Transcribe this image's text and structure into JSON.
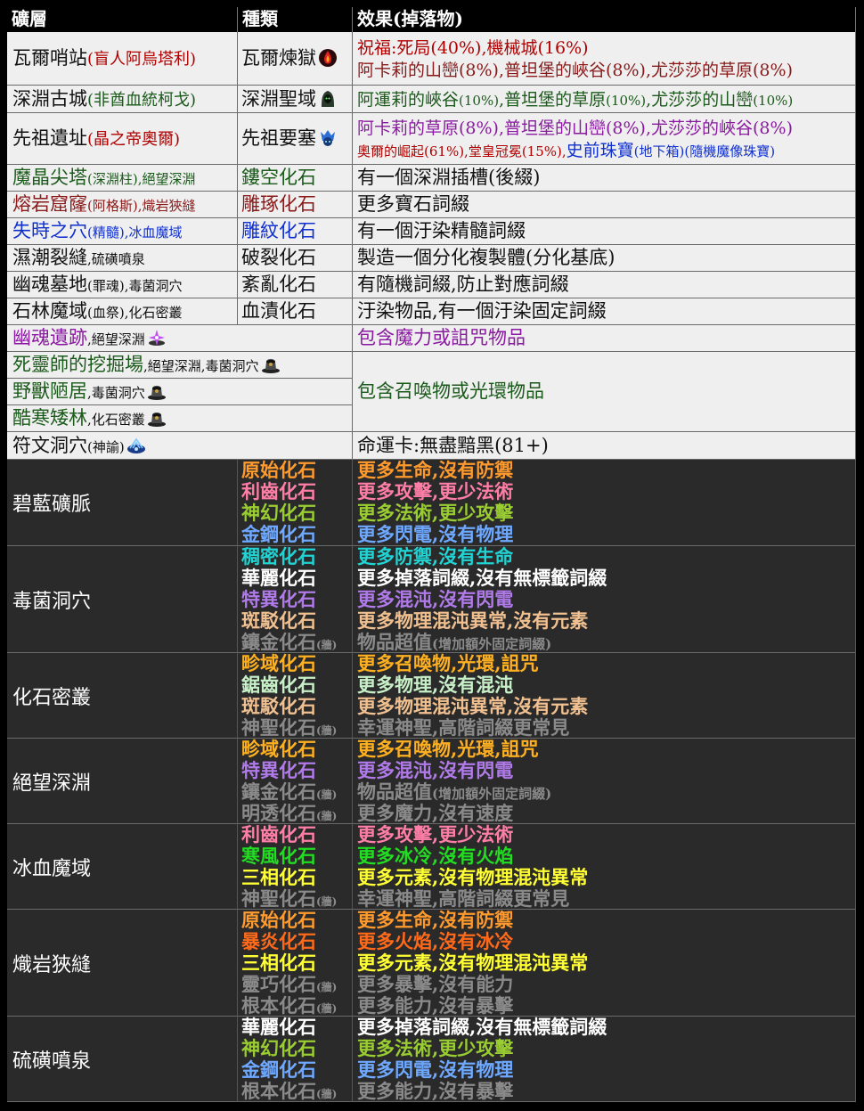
{
  "colors": {
    "red": "#b00000",
    "darkred": "#8a1a1a",
    "green": "#1a5a1a",
    "blue": "#1030d0",
    "purple": "#8a1aa0",
    "black": "#111111"
  },
  "header": {
    "col1": "礦層",
    "col2": "種類",
    "col3": "效果(掉落物)"
  },
  "rows": [
    {
      "area": "瓦爾哨站",
      "area_note": "(盲人阿烏塔利)",
      "kind": "瓦爾煉獄",
      "kind_icon": "vaal-flame-icon",
      "effects": [
        [
          {
            "text": "祝福:死局(40%),機械城(16%)",
            "color": "red"
          }
        ],
        [
          {
            "text": "阿卡莉的山巒(8%),普坦堡的峽谷(8%),尤莎莎的草原(8%)",
            "color": "darkred"
          }
        ]
      ]
    },
    {
      "area": "深淵古城",
      "area_note": "(非酋血統柯戈)",
      "kind": "深淵聖域",
      "kind_icon": "abyss-hood-icon",
      "effects": [
        [
          {
            "text": "阿運莉的峽谷",
            "color": "green"
          },
          {
            "text": "(10%)",
            "color": "green",
            "size": "sm"
          },
          {
            "text": ",普坦堡的草原",
            "color": "green"
          },
          {
            "text": "(10%)",
            "color": "green",
            "size": "sm"
          },
          {
            "text": ",尤莎莎的山巒",
            "color": "green"
          },
          {
            "text": "(10%)",
            "color": "green",
            "size": "sm"
          }
        ]
      ]
    },
    {
      "area": "先祖遺址",
      "area_note": "(晶之帝奧爾)",
      "kind": "先祖要塞",
      "kind_icon": "ancestor-skull-icon",
      "effects": [
        [
          {
            "text": "阿卡莉的草原(8%),普坦堡的山巒(8%),尤莎莎的峽谷(8%)",
            "color": "purple"
          }
        ],
        [
          {
            "text": "奧爾的崛起(61%),堂皇冠冕(15%),",
            "color": "red",
            "size": "sm"
          },
          {
            "text": "史前珠寶",
            "color": "blue"
          },
          {
            "text": "(地下箱)(隨機魔像珠寶)",
            "color": "blue",
            "size": "sm"
          }
        ]
      ]
    },
    {
      "area": "魔晶尖塔",
      "area_note": "(深淵柱),絕望深淵",
      "area_color": "green",
      "kind": "鏤空化石",
      "kind_color": "green",
      "effect": "有一個深淵插槽(後綴)"
    },
    {
      "area": "熔岩窟窿",
      "area_note": "(阿格斯),熾岩狹縫",
      "area_color": "darkred",
      "kind": "雕琢化石",
      "kind_color": "darkred",
      "effect": "更多寶石詞綴"
    },
    {
      "area": "失時之穴",
      "area_note": "(精髓),",
      "area_note2": "冰血魔域",
      "area_color": "blue",
      "kind": "雕紋化石",
      "kind_color": "blue",
      "effect": "有一個汙染精髓詞綴"
    },
    {
      "area": "濕潮裂縫",
      "area_note": ",硫磺噴泉",
      "kind": "破裂化石",
      "effect": "製造一個分化複製體(分化基底)"
    },
    {
      "area": "幽魂墓地",
      "area_note": "(罪魂),毒菌洞穴",
      "kind": "紊亂化石",
      "effect": "有隨機詞綴,防止對應詞綴"
    },
    {
      "area": "石林魔域",
      "area_note": "(血祭),化石密叢",
      "kind": "血漬化石",
      "effect": "汙染物品,有一個汙染固定詞綴"
    }
  ],
  "merged_rows": [
    {
      "area": "幽魂遺跡",
      "area_note": ",絕望深淵",
      "area_color": "purple",
      "icon": "purple-sparkle-icon",
      "effect": "包含魔力或詛咒物品",
      "effect_color": "purple"
    },
    {
      "area": "死靈師的挖掘場",
      "area_note": ",絕望深淵,毒菌洞穴",
      "area_color": "green",
      "icon": "dark-urn-icon"
    },
    {
      "area": "野獸陋居",
      "area_note": ",毒菌洞穴",
      "area_color": "green",
      "icon": "dark-urn-icon"
    },
    {
      "area": "酷寒矮林",
      "area_note": ",化石密叢",
      "area_color": "green",
      "icon": "dark-urn-icon"
    },
    {
      "area": "符文洞穴",
      "area_note": "(神諭)",
      "icon": "blue-rune-icon",
      "effect": "命運卡:無盡黯黑(81+)"
    }
  ],
  "merged_effect_shared": "包含召喚物或光環物品",
  "biomes": [
    {
      "name": "碧藍礦脈",
      "items": [
        {
          "fossil": "原始化石",
          "effect": "更多生命,沒有防禦",
          "color": "#ff9a2e"
        },
        {
          "fossil": "利齒化石",
          "effect": "更多攻擊,更少法術",
          "color": "#ff7ea8"
        },
        {
          "fossil": "神幻化石",
          "effect": "更多法術,更少攻擊",
          "color": "#9acd32"
        },
        {
          "fossil": "金鋼化石",
          "effect": "更多閃電,沒有物理",
          "color": "#6ea8ff"
        }
      ]
    },
    {
      "name": "毒菌洞穴",
      "items": [
        {
          "fossil": "稠密化石",
          "effect": "更多防禦,沒有生命",
          "color": "#22d3d3"
        },
        {
          "fossil": "華麗化石",
          "effect": "更多掉落詞綴,沒有無標籤詞綴",
          "color": "#ffffff"
        },
        {
          "fossil": "特異化石",
          "effect": "更多混沌,沒有閃電",
          "color": "#b07ae8"
        },
        {
          "fossil": "斑駁化石",
          "effect": "更多物理混沌異常,沒有元素",
          "color": "#f0c090"
        },
        {
          "fossil": "鑲金化石",
          "tag": "(牆)",
          "effect": "物品超值",
          "effect_note": "(增加額外固定詞綴)",
          "color": "#8a8a8a"
        }
      ]
    },
    {
      "name": "化石密叢",
      "items": [
        {
          "fossil": "畛域化石",
          "effect": "更多召喚物,光環,詛咒",
          "color": "#ffb020"
        },
        {
          "fossil": "鋸齒化石",
          "effect": "更多物理,沒有混沌",
          "color": "#c8f0c8"
        },
        {
          "fossil": "斑駁化石",
          "effect": "更多物理混沌異常,沒有元素",
          "color": "#f0c090"
        },
        {
          "fossil": "神聖化石",
          "tag": "(牆)",
          "effect": "幸運神聖,高階詞綴更常見",
          "color": "#8a8a8a"
        }
      ]
    },
    {
      "name": "絕望深淵",
      "items": [
        {
          "fossil": "畛域化石",
          "effect": "更多召喚物,光環,詛咒",
          "color": "#ffb020"
        },
        {
          "fossil": "特異化石",
          "effect": "更多混沌,沒有閃電",
          "color": "#b07ae8"
        },
        {
          "fossil": "鑲金化石",
          "tag": "(牆)",
          "effect": "物品超值",
          "effect_note": "(增加額外固定詞綴)",
          "color": "#8a8a8a"
        },
        {
          "fossil": "明透化石",
          "tag": "(牆)",
          "effect": "更多魔力,沒有速度",
          "color": "#8a8a8a"
        }
      ]
    },
    {
      "name": "冰血魔域",
      "items": [
        {
          "fossil": "利齒化石",
          "effect": "更多攻擊,更少法術",
          "color": "#ff7ea8"
        },
        {
          "fossil": "寒風化石",
          "effect": "更多冰冷,沒有火焰",
          "color": "#22dd22"
        },
        {
          "fossil": "三相化石",
          "effect": "更多元素,沒有物理混沌異常",
          "color": "#ffff33"
        },
        {
          "fossil": "神聖化石",
          "tag": "(牆)",
          "effect": "幸運神聖,高階詞綴更常見",
          "color": "#8a8a8a"
        }
      ]
    },
    {
      "name": "熾岩狹縫",
      "items": [
        {
          "fossil": "原始化石",
          "effect": "更多生命,沒有防禦",
          "color": "#ff9a2e"
        },
        {
          "fossil": "暴炎化石",
          "effect": "更多火焰,沒有冰冷",
          "color": "#ff6a1a"
        },
        {
          "fossil": "三相化石",
          "effect": "更多元素,沒有物理混沌異常",
          "color": "#ffff33"
        },
        {
          "fossil": "靈巧化石",
          "tag": "(牆)",
          "effect": "更多暴擊,沒有能力",
          "color": "#8a8a8a"
        },
        {
          "fossil": "根本化石",
          "tag": "(牆)",
          "effect": "更多能力,沒有暴擊",
          "color": "#8a8a8a"
        }
      ]
    },
    {
      "name": "硫磺噴泉",
      "items": [
        {
          "fossil": "華麗化石",
          "effect": "更多掉落詞綴,沒有無標籤詞綴",
          "color": "#ffffff"
        },
        {
          "fossil": "神幻化石",
          "effect": "更多法術,更少攻擊",
          "color": "#9acd32"
        },
        {
          "fossil": "金鋼化石",
          "effect": "更多閃電,沒有物理",
          "color": "#6ea8ff"
        },
        {
          "fossil": "根本化石",
          "tag": "(牆)",
          "effect": "更多能力,沒有暴擊",
          "color": "#8a8a8a"
        }
      ]
    }
  ]
}
